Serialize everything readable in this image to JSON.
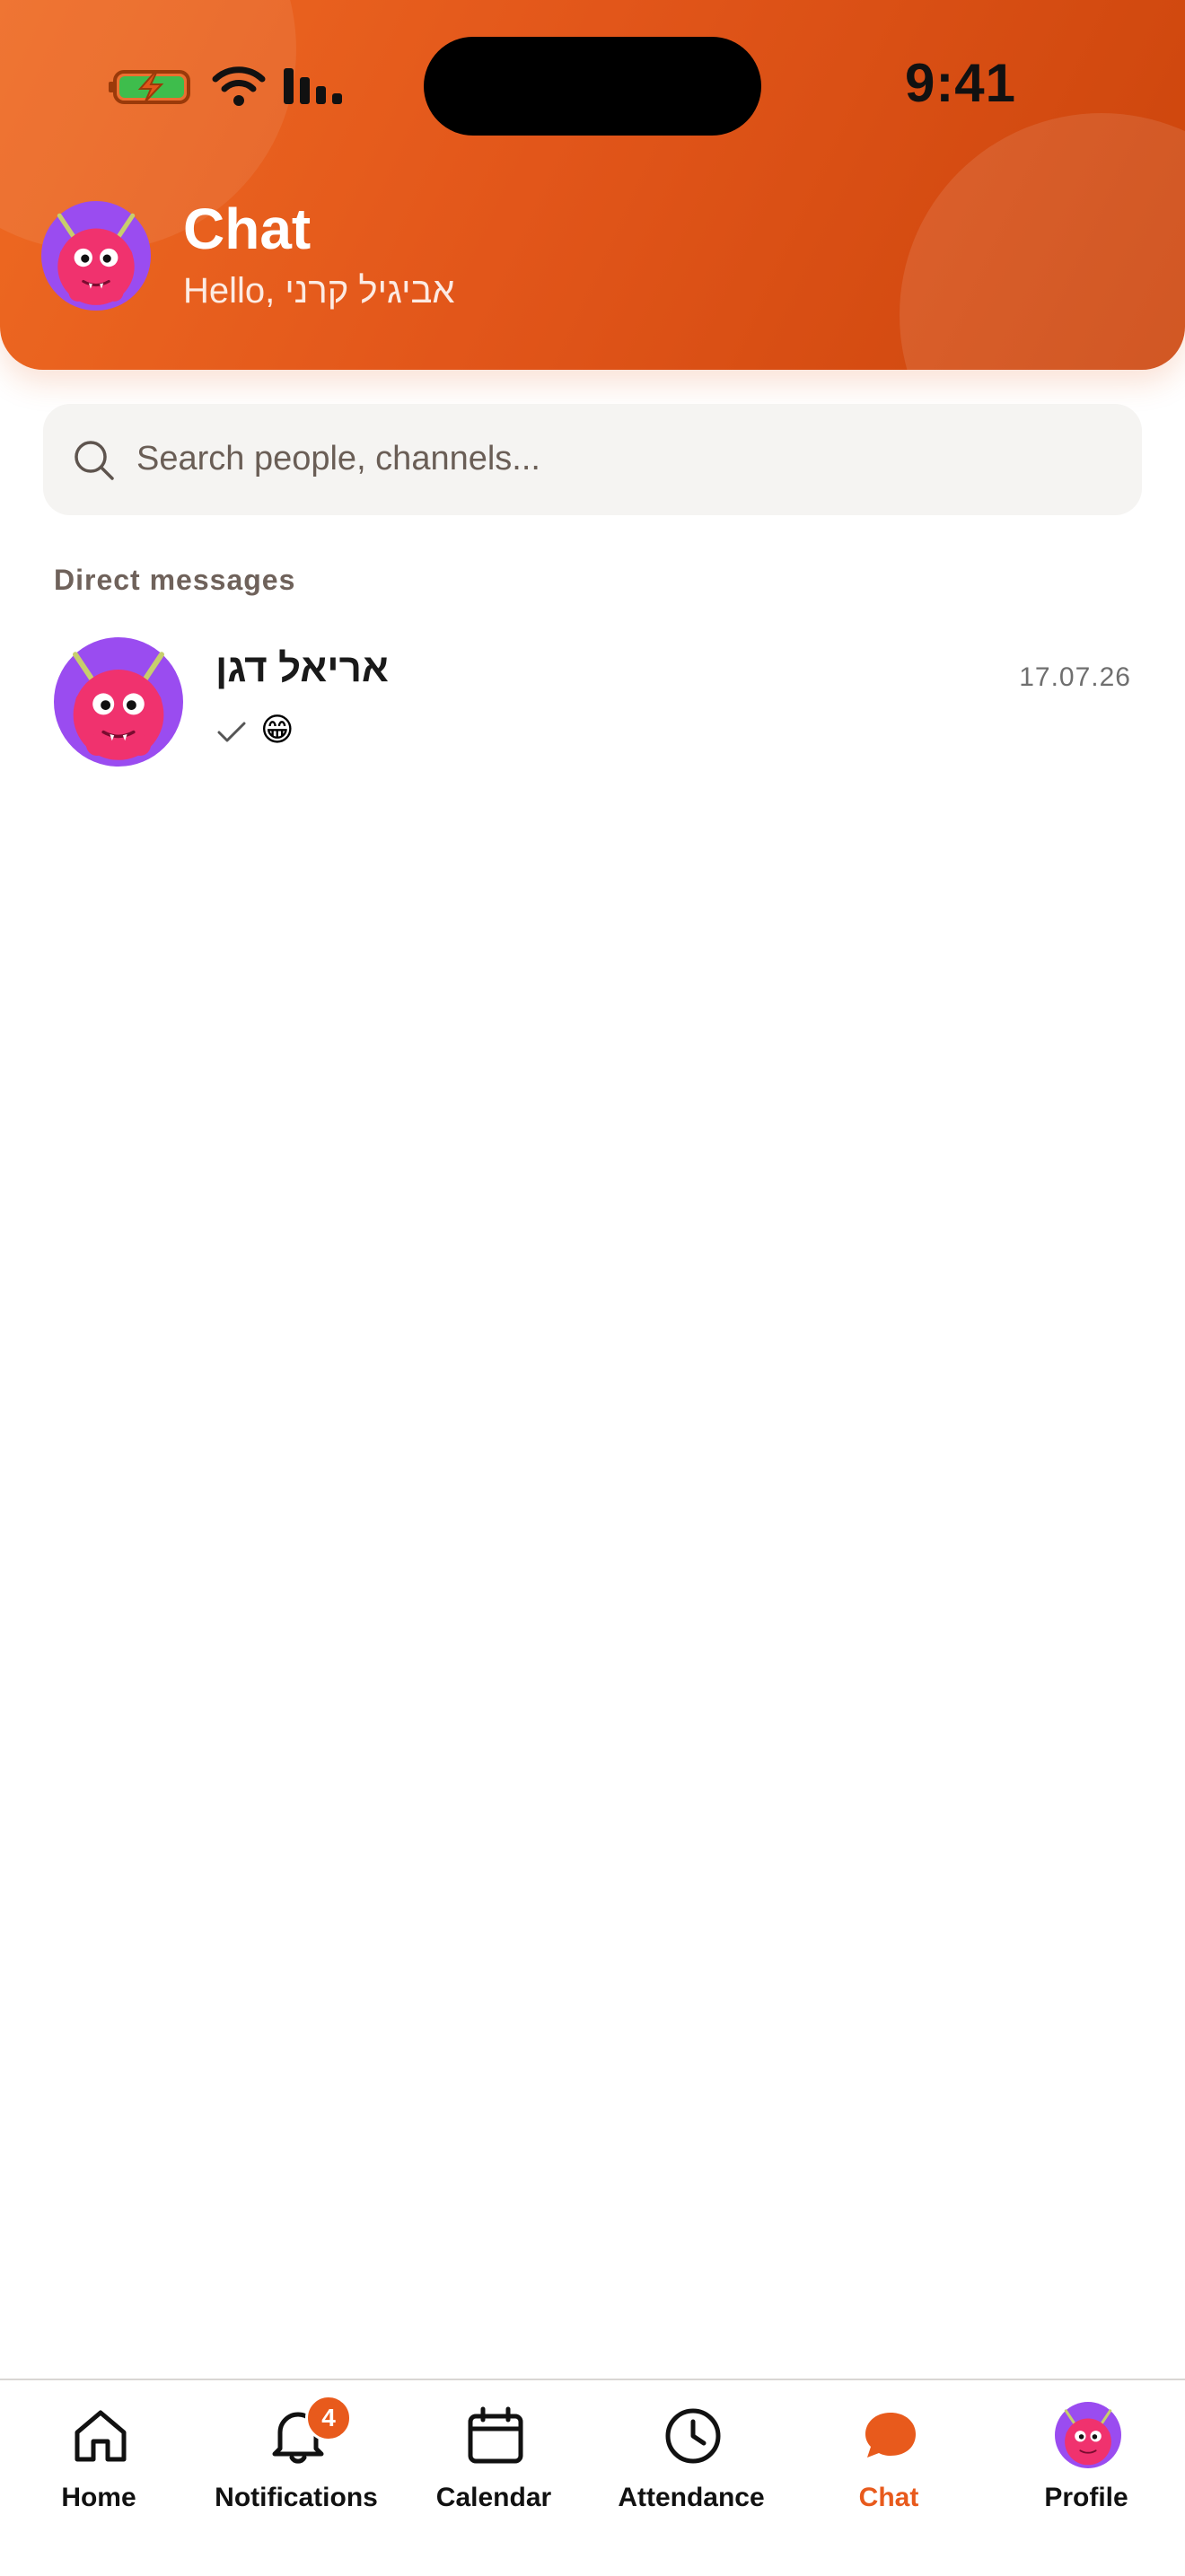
{
  "status_bar": {
    "time": "9:41"
  },
  "header": {
    "title": "Chat",
    "subtitle": "Hello, אביגיל קרני",
    "accent_color": "#e2561a"
  },
  "search": {
    "placeholder": "Search people, channels..."
  },
  "direct_messages": {
    "label": "Direct messages",
    "items": [
      {
        "name": "אריאל דגן",
        "date": "17.07.26",
        "preview": "😁",
        "status_icon": "check-icon"
      }
    ]
  },
  "bottom_nav": {
    "items": [
      {
        "label": "Home",
        "icon": "home-icon"
      },
      {
        "label": "Notifications",
        "icon": "bell-icon",
        "badge": "4"
      },
      {
        "label": "Calendar",
        "icon": "calendar-icon"
      },
      {
        "label": "Attendance",
        "icon": "clock-icon"
      },
      {
        "label": "Chat",
        "icon": "chat-bubble-icon",
        "active": true
      },
      {
        "label": "Profile",
        "icon": "avatar"
      }
    ]
  }
}
